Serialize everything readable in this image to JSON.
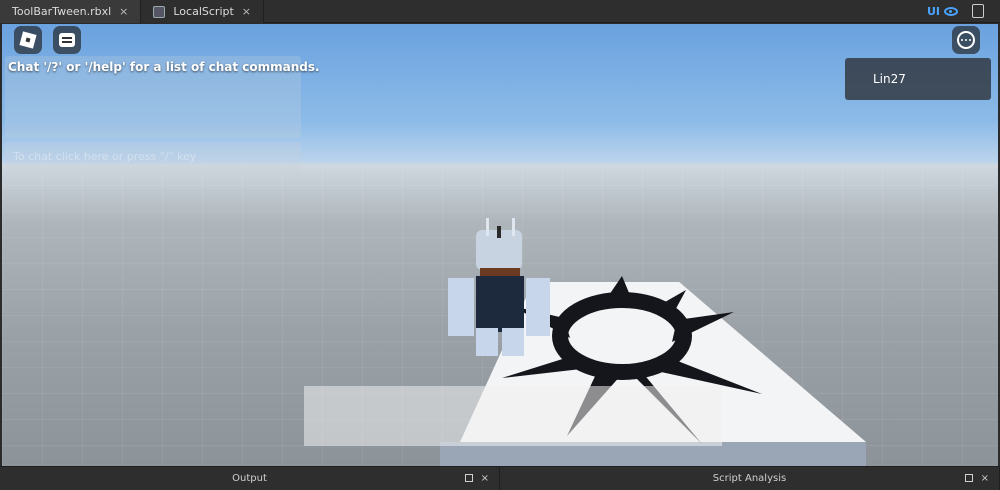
{
  "tabs": [
    {
      "label": "ToolBarTween.rbxl",
      "close": "×"
    },
    {
      "label": "LocalScript",
      "close": "×"
    }
  ],
  "tabbar": {
    "ui_label": "UI"
  },
  "chat": {
    "message": "Chat '/?' or '/help' for a list of chat commands.",
    "input_placeholder": "To chat click here or press \"/\" key"
  },
  "playerlist": {
    "player": "Lin27"
  },
  "bottom_panels": [
    {
      "title": "Output",
      "restore": "",
      "close": "×"
    },
    {
      "title": "Script Analysis",
      "restore": "",
      "close": "×"
    }
  ],
  "colors": {
    "accent": "#4aa3ff",
    "sky_top": "#6aa2df",
    "ground": "#9aa1a7"
  }
}
